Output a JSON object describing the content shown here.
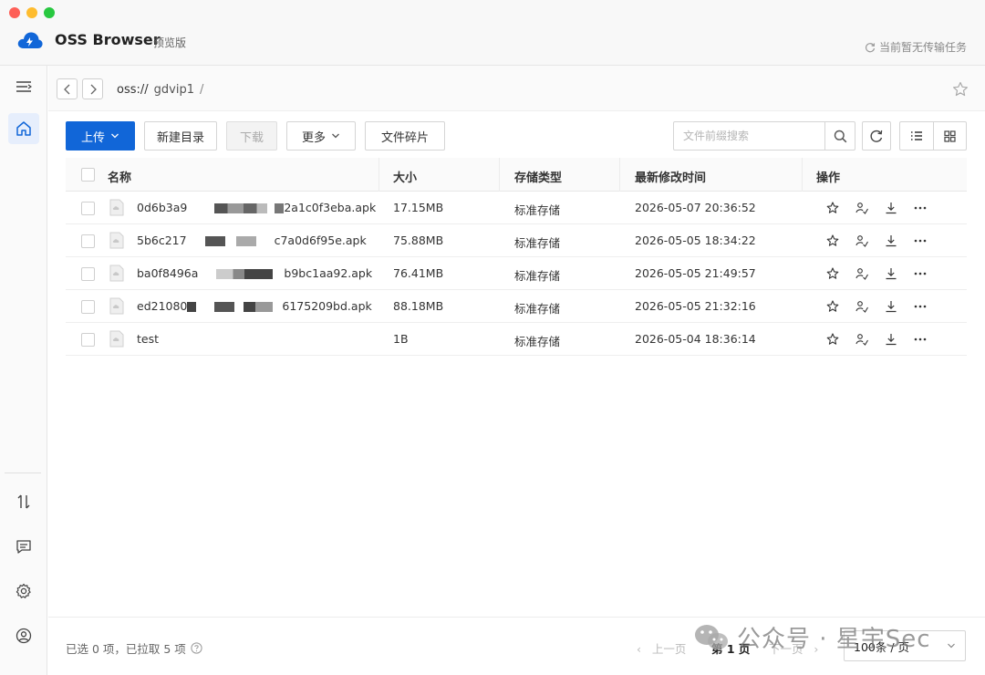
{
  "app": {
    "name": "OSS Browser",
    "tag": "预览版",
    "transfer_status": "当前暂无传输任务"
  },
  "address": {
    "scheme": "oss://",
    "bucket": "gdvip1",
    "slash": "/"
  },
  "toolbar": {
    "upload_label": "上传",
    "new_dir_label": "新建目录",
    "download_label": "下载",
    "more_label": "更多",
    "fragments_label": "文件碎片",
    "search_placeholder": "文件前缀搜索"
  },
  "table": {
    "headers": {
      "name": "名称",
      "size": "大小",
      "storage": "存储类型",
      "modified": "最新修改时间",
      "ops": "操作"
    },
    "rows": [
      {
        "name_start": "0d6b3a9",
        "name_end": "2a1c0f3eba.apk",
        "size": "17.15MB",
        "storage": "标准存储",
        "modified": "2026-05-07 20:36:52"
      },
      {
        "name_start": "5b6c217",
        "name_end": "c7a0d6f95e.apk",
        "size": "75.88MB",
        "storage": "标准存储",
        "modified": "2026-05-05 18:34:22"
      },
      {
        "name_start": "ba0f8496a",
        "name_end": "b9bc1aa92.apk",
        "size": "76.41MB",
        "storage": "标准存储",
        "modified": "2026-05-05 21:49:57"
      },
      {
        "name_start": "ed21080",
        "name_end": "6175209bd.apk",
        "size": "88.18MB",
        "storage": "标准存储",
        "modified": "2026-05-05 21:32:16"
      },
      {
        "name_start": "test",
        "name_end": "",
        "size": "1B",
        "storage": "标准存储",
        "modified": "2026-05-04 18:36:14"
      }
    ]
  },
  "footer": {
    "selection_info": "已选 0 项，已拉取 5 项",
    "prev_label": "上一页",
    "current_page": "第 1 页",
    "next_label": "下一页",
    "page_size": "100条 / 页"
  },
  "watermark": {
    "text": "公众号 · 星宇Sec"
  },
  "colors": {
    "primary": "#1166d8",
    "active_bg": "#e6eefc"
  }
}
